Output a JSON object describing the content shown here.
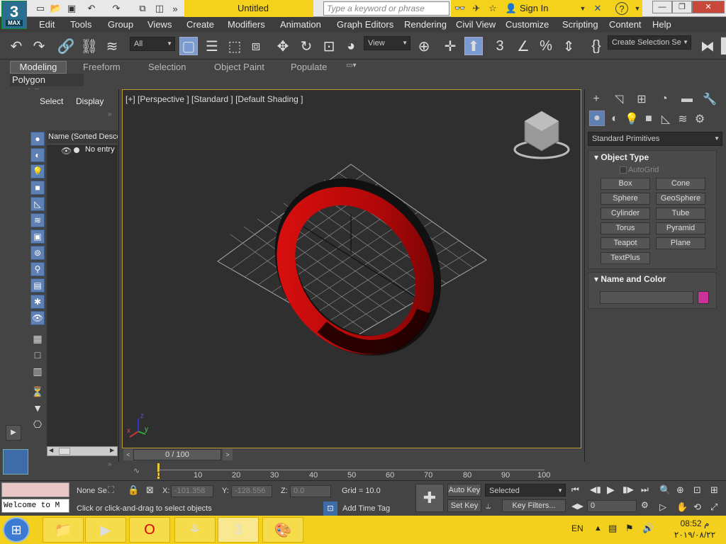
{
  "app": {
    "title": "Untitled",
    "logo_number": "3",
    "logo_text": "MAX",
    "search_placeholder": "Type a keyword or phrase",
    "sign_in": "Sign In"
  },
  "menu": [
    "Edit",
    "Tools",
    "Group",
    "Views",
    "Create",
    "Modifiers",
    "Animation",
    "Graph Editors",
    "Rendering",
    "Civil View",
    "Customize",
    "Scripting",
    "Content",
    "Help"
  ],
  "toolbar": {
    "filter_value": "All",
    "view_value": "View",
    "selection_set": "Create Selection Se"
  },
  "ribbon": {
    "tabs": [
      "Modeling",
      "Freeform",
      "Selection",
      "Object Paint",
      "Populate"
    ],
    "panel_label": "Polygon Modeling"
  },
  "explorer": {
    "tabs": [
      "Select",
      "Display"
    ],
    "column_header": "Name (Sorted Desce",
    "entry": "No entry"
  },
  "viewport": {
    "label": "[+] [Perspective ] [Standard ] [Default Shading ]"
  },
  "command_panel": {
    "category": "Standard Primitives",
    "object_type_title": "Object Type",
    "autogrid": "AutoGrid",
    "buttons": [
      "Box",
      "Cone",
      "Sphere",
      "GeoSphere",
      "Cylinder",
      "Tube",
      "Torus",
      "Pyramid",
      "Teapot",
      "Plane",
      "TextPlus"
    ],
    "name_color_title": "Name and Color",
    "object_color": "#cc3399"
  },
  "time": {
    "slider": "0 / 100",
    "ticks": [
      "0",
      "10",
      "20",
      "30",
      "40",
      "50",
      "60",
      "70",
      "80",
      "90",
      "100"
    ]
  },
  "status": {
    "maxscript": "Welcome to M",
    "selection": "None Se",
    "x_label": "X:",
    "x_value": "-101.358",
    "y_label": "Y:",
    "y_value": "-128.556",
    "z_label": "Z:",
    "z_value": "0.0",
    "grid": "Grid = 10.0",
    "prompt": "Click or click-and-drag to select objects",
    "add_time_tag": "Add Time Tag",
    "auto_key": "Auto Key",
    "set_key": "Set Key",
    "selected": "Selected",
    "key_filters": "Key Filters...",
    "frame": "0"
  },
  "taskbar": {
    "lang": "EN",
    "time": "08:52 م",
    "date": "۲۰۱۹/۰۸/۲۲"
  }
}
